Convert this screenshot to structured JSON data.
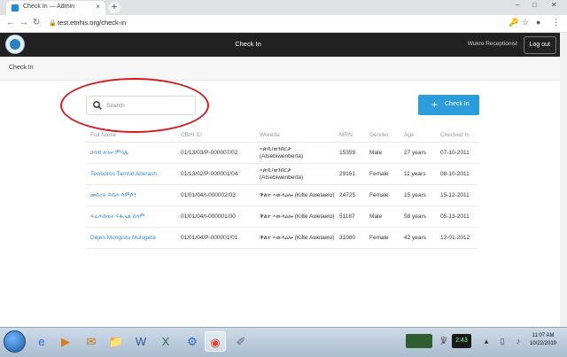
{
  "browser": {
    "tab_title": "Check In — Admin",
    "tab_close": "×",
    "new_tab": "+",
    "url": "test.etnhis.org/check-in",
    "win_minimize": "–",
    "win_maximize": "□",
    "win_close": "✕"
  },
  "app": {
    "title": "Check In",
    "user_role": "Wukro Receptionist",
    "logout_label": "Log out",
    "page_heading": "Check In",
    "search_placeholder": "Search",
    "checkin_button": "Check In",
    "accent_color": "#2d9cdb",
    "annotation_color": "#d51c22"
  },
  "table": {
    "columns": [
      "Full Name",
      "CBHI ID",
      "Woreda",
      "MRN",
      "Gender",
      "Age",
      "Checked In"
    ],
    "rows": [
      {
        "name": "ሀሳብ ለገሠ ምሳሌ",
        "cbhi": "01/13/03/P-000007/02",
        "woreda": "ኣጽቢ/ወንበርታ (Atsebiwenberta)",
        "mrn": "15359",
        "gender": "Male",
        "age": "27 years",
        "checked_in": "07-10-2011"
      },
      {
        "name": "Tewodros Tamrat Aberash",
        "cbhi": "01/13/02/P-000001/04",
        "woreda": "ኣጽቢ/ወንበርታ (Atsebiwenberta)",
        "mrn": "29161",
        "gender": "Female",
        "age": "11 years",
        "checked_in": "08-10-2011"
      },
      {
        "name": "መሰረት ፍሰሐ ሳምሶን",
        "cbhi": "01/01/04/I-000002/03",
        "woreda": "ቕልተ ኣውላዕሎ (Kilte Awelaelo)",
        "mrn": "24725",
        "gender": "Female",
        "age": "15 years",
        "checked_in": "15-12-2011"
      },
      {
        "name": "ፍሬሕይወት ሩፋኤል ሰላም",
        "cbhi": "01/01/04/I-000001/00",
        "woreda": "ቕልተ ኣውላዕሎ (Kilte Awelaelo)",
        "mrn": "51187",
        "gender": "Male",
        "age": "58 years",
        "checked_in": "05-13-2011"
      },
      {
        "name": "Dejen Mengistu Mulugeta",
        "cbhi": "01/01/04/P-000001/01",
        "woreda": "ቕልተ ኣውላዕሎ (Kilte Awelaelo)",
        "mrn": "31080",
        "gender": "Female",
        "age": "42 years",
        "checked_in": "12-01-2012"
      }
    ]
  },
  "taskbar": {
    "battery_label": "2:43",
    "time": "11:07 AM",
    "date": "10/22/2019"
  }
}
